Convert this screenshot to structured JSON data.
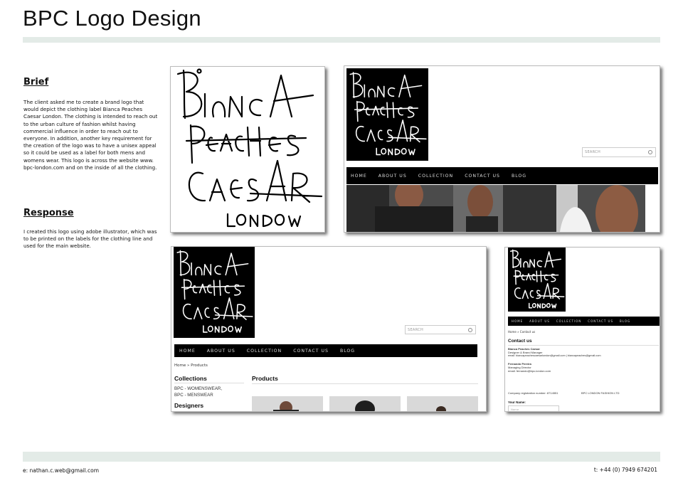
{
  "page": {
    "title": "BPC Logo Design"
  },
  "brief": {
    "heading": "Brief",
    "body": "The client asked me to create a brand logo that would depict the clothing label Bianca Peaches Caesar London. The clothing is intended to reach out to the urban culture of fashion whilst having commercial influence in order to reach out to everyone. In addition, another key requirement for the creation of the logo was to have a unisex appeal so it could be used as a label for both mens and womens wear. This logo is across the website www. bpc-london.com and on the inside of all the clothing."
  },
  "response": {
    "heading": "Response",
    "body": "I created this logo using adobe illustrator, which was to be printed on the labels for the clothing line and used for the main website."
  },
  "footer": {
    "email": "e: nathan.c.web@gmail.com",
    "phone": "t: +44 (0) 7949 674201"
  },
  "website": {
    "search_placeholder": "SEARCH",
    "nav": [
      "HOME",
      "ABOUT US",
      "COLLECTION",
      "CONTACT US",
      "BLOG"
    ],
    "products_page": {
      "breadcrumb": "Home  »  Products",
      "collections_heading": "Collections",
      "collections": [
        "BPC - WOMENSWEAR,",
        "BPC - MENSWEAR"
      ],
      "designers_heading": "Designers",
      "products_heading": "Products"
    },
    "contact_page": {
      "breadcrumb": "Home  »  Contact us",
      "heading": "Contact us",
      "person1_name": "Bianca Peaches Caesar",
      "person1_role": "Designer & Brand Manager",
      "person1_email": "email: biancapeachescaesarlondon@gmail.com  |  biancapeaches@gmail.com",
      "person2_name": "Fernando Pereira",
      "person2_role": "Managing Director",
      "person2_email": "email: fernando@bpc-london.com",
      "company_reg": "Company registration number: 8714551",
      "company_name": "BPC LONDON FASHION LTD",
      "form_label": "Your Name:",
      "form_placeholder": "Name"
    }
  },
  "colors": {
    "band": "#e3ebe7",
    "navbar": "#000000"
  }
}
